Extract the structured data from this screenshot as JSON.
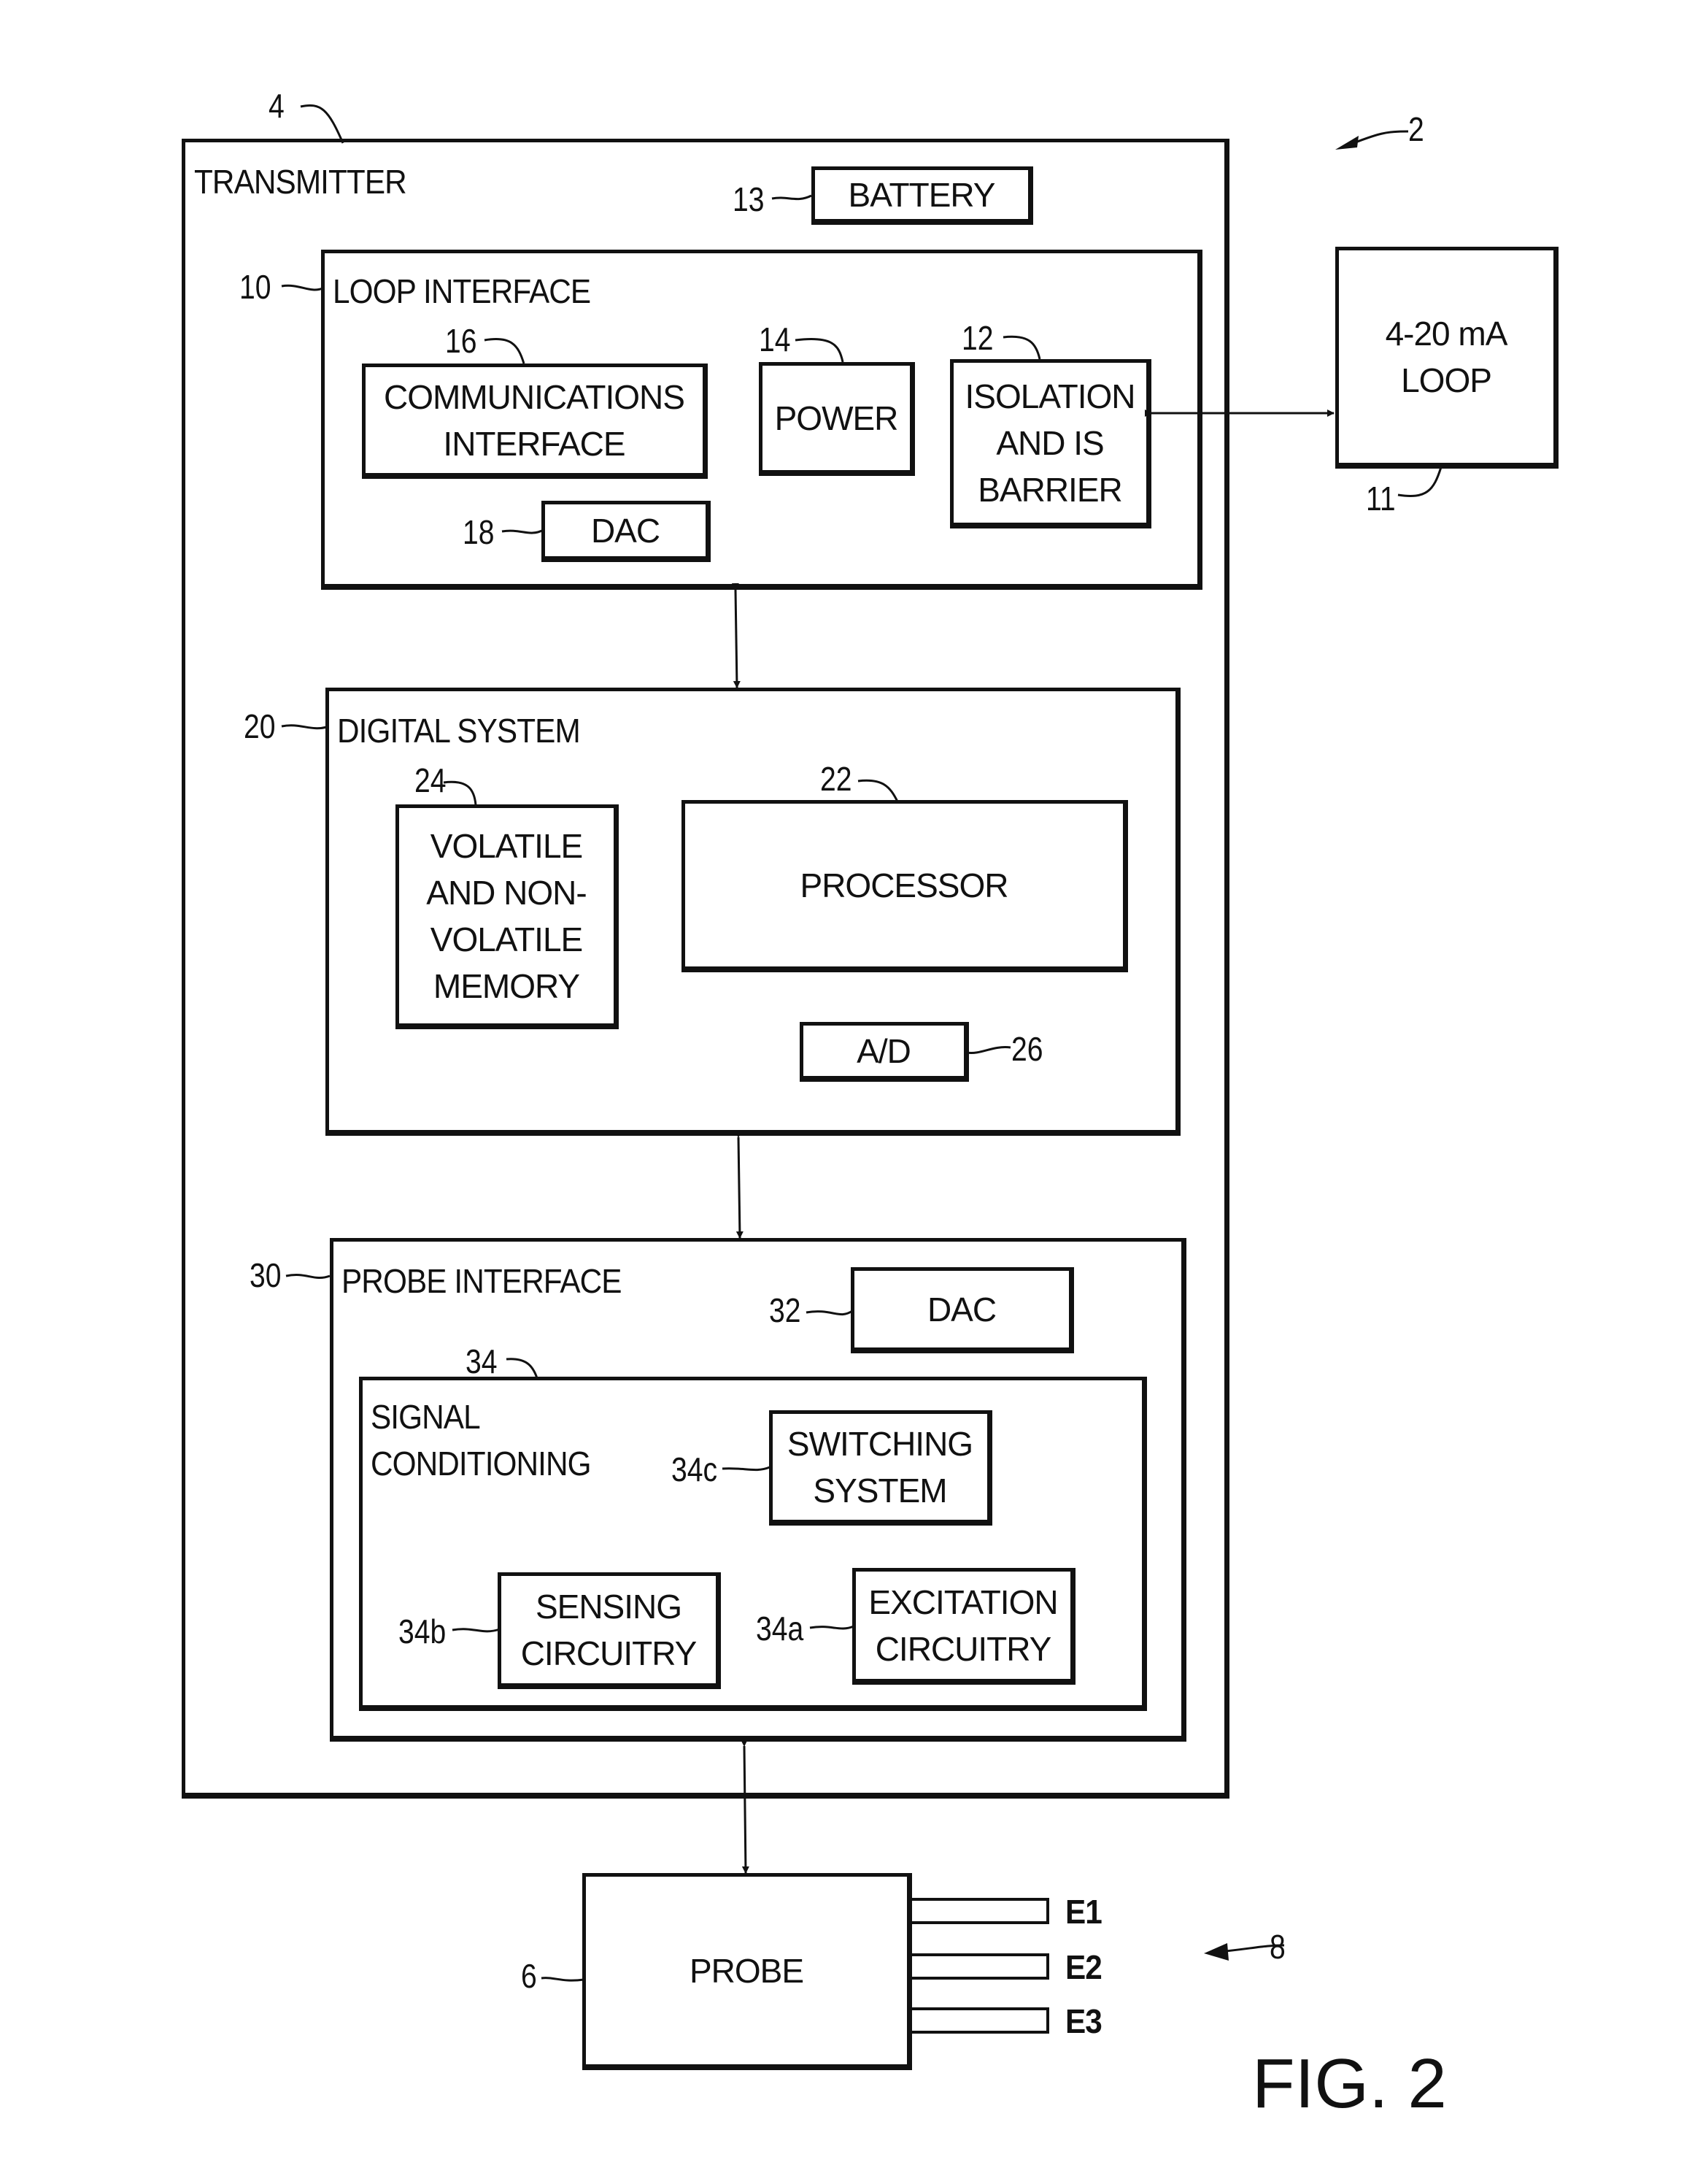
{
  "figure": {
    "label": "FIG. 2",
    "system_ref": "2",
    "electrode_group_ref": "8"
  },
  "transmitter": {
    "ref": "4",
    "title": "TRANSMITTER",
    "battery": {
      "ref": "13",
      "label": "BATTERY"
    },
    "loop_interface": {
      "ref": "10",
      "title": "LOOP INTERFACE",
      "communications": {
        "ref": "16",
        "line1": "COMMUNICATIONS",
        "line2": "INTERFACE"
      },
      "power": {
        "ref": "14",
        "label": "POWER"
      },
      "isolation": {
        "ref": "12",
        "line1": "ISOLATION",
        "line2": "AND IS",
        "line3": "BARRIER"
      },
      "dac": {
        "ref": "18",
        "label": "DAC"
      }
    },
    "digital_system": {
      "ref": "20",
      "title": "DIGITAL SYSTEM",
      "memory": {
        "ref": "24",
        "line1": "VOLATILE",
        "line2": "AND NON-",
        "line3": "VOLATILE",
        "line4": "MEMORY"
      },
      "processor": {
        "ref": "22",
        "label": "PROCESSOR"
      },
      "ad": {
        "ref": "26",
        "label": "A/D"
      }
    },
    "probe_interface": {
      "ref": "30",
      "title": "PROBE INTERFACE",
      "dac": {
        "ref": "32",
        "label": "DAC"
      },
      "signal_conditioning": {
        "ref": "34",
        "line1": "SIGNAL",
        "line2": "CONDITIONING",
        "switching": {
          "ref": "34c",
          "line1": "SWITCHING",
          "line2": "SYSTEM"
        },
        "sensing": {
          "ref": "34b",
          "line1": "SENSING",
          "line2": "CIRCUITRY"
        },
        "excitation": {
          "ref": "34a",
          "line1": "EXCITATION",
          "line2": "CIRCUITRY"
        }
      }
    }
  },
  "loop": {
    "ref": "11",
    "line1": "4-20 mA",
    "line2": "LOOP"
  },
  "probe": {
    "ref": "6",
    "label": "PROBE",
    "electrodes": [
      "E1",
      "E2",
      "E3"
    ]
  }
}
